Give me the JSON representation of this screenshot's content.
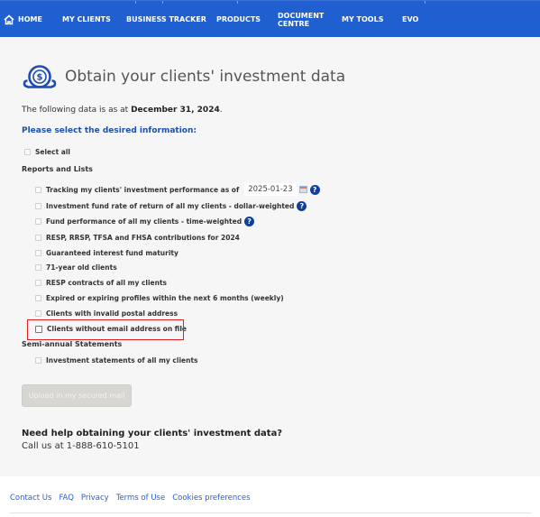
{
  "nav": {
    "items": [
      {
        "label": "HOME",
        "icon": "home-icon"
      },
      {
        "label": "MY CLIENTS"
      },
      {
        "label": "BUSINESS TRACKER"
      },
      {
        "label": "PRODUCTS"
      },
      {
        "label": "DOCUMENT CENTRE"
      },
      {
        "label": "MY TOOLS"
      },
      {
        "label": "EVO"
      }
    ],
    "background_color": "#1f5fd0"
  },
  "page": {
    "icon": "money-bag-dollar-icon",
    "title": "Obtain your clients' investment data",
    "as_at_prefix": "The following data is as at ",
    "as_at_date": "December 31, 2024",
    "as_at_suffix": ".",
    "prompt": "Please select the desired information:",
    "select_all": {
      "label": "Select all",
      "checked": false
    }
  },
  "sections": {
    "reports": {
      "title": "Reports and Lists",
      "items": [
        {
          "label": "Tracking my clients' investment performance as of",
          "checked": false,
          "date_value": "2025-01-23",
          "has_calendar": true,
          "has_help": true
        },
        {
          "label": "Investment fund rate of return of all my clients - dollar-weighted",
          "checked": false,
          "has_help": true
        },
        {
          "label": "Fund performance of all my clients - time-weighted",
          "checked": false,
          "has_help": true
        },
        {
          "label": "RESP, RRSP, TFSA and FHSA contributions for 2024",
          "checked": false
        },
        {
          "label": "Guaranteed interest fund maturity",
          "checked": false
        },
        {
          "label": "71-year old clients",
          "checked": false
        },
        {
          "label": "RESP contracts of all my clients",
          "checked": false
        },
        {
          "label": "Expired or expiring profiles within the next 6 months (weekly)",
          "checked": false
        },
        {
          "label": "Clients with invalid postal address",
          "checked": false
        },
        {
          "label": "Clients without email address on file",
          "checked": false,
          "highlighted": true
        }
      ]
    },
    "statements": {
      "title": "Semi-annual Statements",
      "items": [
        {
          "label": "Investment statements of all my clients",
          "checked": false
        }
      ]
    }
  },
  "actions": {
    "upload_label": "Upload in my secured mail",
    "upload_enabled": false
  },
  "help": {
    "title": "Need help obtaining your clients' investment data?",
    "phone_text": "Call us at 1-888-610-5101"
  },
  "footer": {
    "links": [
      "Contact Us",
      "FAQ",
      "Privacy",
      "Terms of Use",
      "Cookies preferences"
    ]
  },
  "colors": {
    "accent": "#1f5fd0",
    "prompt": "#1f4fa8",
    "highlight_border": "#e02020",
    "help_icon": "#0e3f9e",
    "link": "#2a5fc9"
  }
}
